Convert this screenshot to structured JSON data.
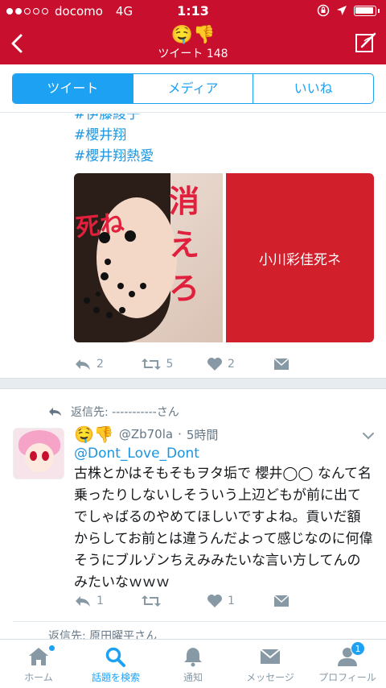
{
  "status_bar": {
    "carrier": "docomo",
    "network": "4G",
    "time": "1:13"
  },
  "nav": {
    "title_emoji": "🤤👎",
    "subtitle": "ツイート 148"
  },
  "segments": [
    {
      "label": "ツイート",
      "active": true
    },
    {
      "label": "メディア",
      "active": false
    },
    {
      "label": "いいね",
      "active": false
    }
  ],
  "tweet1": {
    "hashtags": [
      "#伊藤綾子",
      "#櫻井翔",
      "#櫻井翔熱愛"
    ],
    "photo_scribbles": {
      "left": "死ね",
      "right": "消えろ"
    },
    "media_card_text": "小川彩佳死ネ",
    "actions": {
      "reply_count": "2",
      "retweet_count": "5",
      "like_count": "2"
    }
  },
  "tweet2": {
    "reply_to": "返信先: -----------さん",
    "author_emojis": "🤤👎",
    "handle": "@Zb70la",
    "time": "5時間",
    "mention": "@Dont_Love_Dont",
    "text": "古株とかはそもそもヲタ垢で 櫻井◯◯ なんて名乗ったりしないしそういう上辺どもが前に出てでしゃばるのやめてほしいですよね。貢いだ額からしてお前とは違うんだよって感じなのに何偉そうにブルゾンちえみみたいな言い方してんのみたいなｗｗｗ",
    "actions": {
      "reply_count": "1",
      "retweet_count": "",
      "like_count": "1"
    }
  },
  "next_tweet_peek": "返信先: 原田曜平さん",
  "tabbar": [
    {
      "label": "ホーム",
      "icon": "home-icon",
      "active": false,
      "dot": true
    },
    {
      "label": "話題を検索",
      "icon": "search-icon",
      "active": true
    },
    {
      "label": "通知",
      "icon": "bell-icon",
      "active": false
    },
    {
      "label": "メッセージ",
      "icon": "envelope-icon",
      "active": false
    },
    {
      "label": "プロフィール",
      "icon": "person-icon",
      "active": false,
      "badge": "1"
    }
  ],
  "colors": {
    "brand_red": "#c8102e",
    "twitter_blue": "#1da1f2",
    "link_blue": "#1b95e0",
    "muted": "#8899a6"
  }
}
